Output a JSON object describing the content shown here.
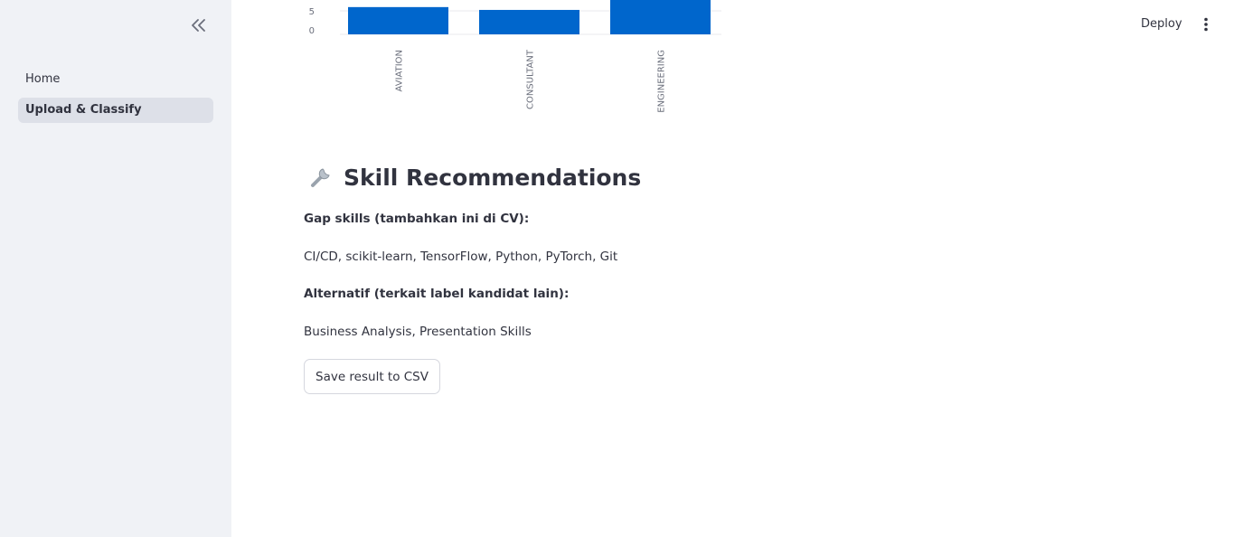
{
  "sidebar": {
    "collapse_icon": "double-chevron-left-icon",
    "items": [
      {
        "label": "Home",
        "active": false
      },
      {
        "label": "Upload & Classify",
        "active": true
      }
    ]
  },
  "header": {
    "deploy_label": "Deploy",
    "menu_icon": "vertical-dots-icon"
  },
  "chart_data": {
    "type": "bar",
    "categories": [
      "AVIATION",
      "CONSULTANT",
      "ENGINEERING"
    ],
    "values": [
      5.8,
      5.2,
      8
    ],
    "y_ticks_visible": [
      "0",
      "5"
    ],
    "ylim_visible": [
      0,
      8
    ],
    "bar_color": "#0066cc",
    "grid": true
  },
  "recommendations": {
    "icon": "wrench-icon",
    "title": "Skill Recommendations",
    "gap_label": "Gap skills (tambahkan ini di CV):",
    "gap_skills": "CI/CD, scikit-learn, TensorFlow, Python, PyTorch, Git",
    "alt_label": "Alternatif (terkait label kandidat lain):",
    "alt_skills": "Business Analysis, Presentation Skills"
  },
  "actions": {
    "save_label": "Save result to CSV"
  }
}
